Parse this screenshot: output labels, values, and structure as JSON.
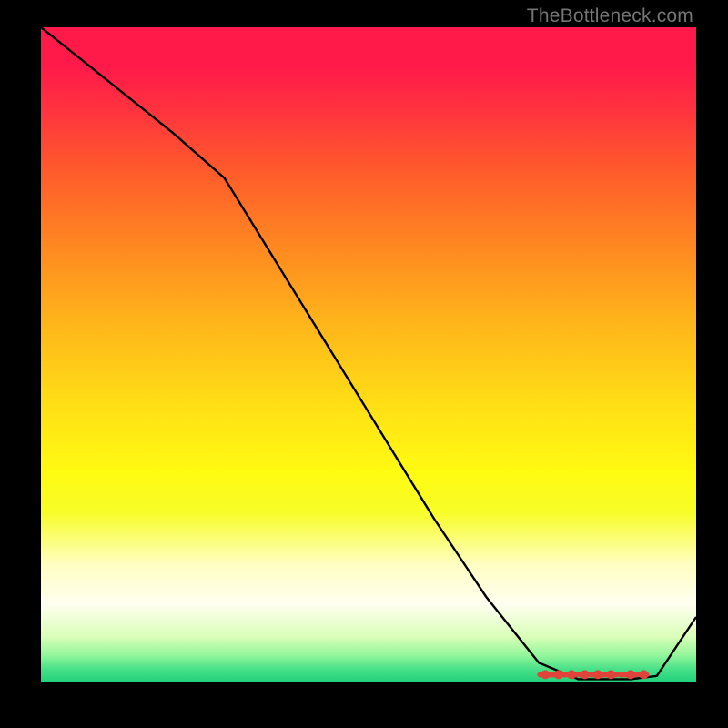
{
  "watermark": "TheBottleneck.com",
  "chart_data": {
    "type": "line",
    "title": "",
    "xlabel": "",
    "ylabel": "",
    "xlim": [
      0,
      100
    ],
    "ylim": [
      0,
      100
    ],
    "grid": false,
    "legend": false,
    "series": [
      {
        "name": "curve",
        "x": [
          0,
          10,
          20,
          28,
          36,
          44,
          52,
          60,
          68,
          76,
          82,
          86,
          90,
          94,
          100
        ],
        "values": [
          100,
          92,
          84,
          77,
          64,
          51,
          38,
          25,
          13,
          3,
          0.5,
          0.5,
          0.5,
          1,
          10
        ]
      }
    ],
    "markers": {
      "name": "bottom-cluster",
      "color": "#e0433a",
      "points": [
        {
          "x": 77,
          "y": 1.2
        },
        {
          "x": 79,
          "y": 1.2
        },
        {
          "x": 81,
          "y": 1.2
        },
        {
          "x": 83,
          "y": 1.2
        },
        {
          "x": 85,
          "y": 1.2
        },
        {
          "x": 87,
          "y": 1.2
        },
        {
          "x": 90,
          "y": 1.2
        },
        {
          "x": 92,
          "y": 1.2
        }
      ]
    }
  }
}
